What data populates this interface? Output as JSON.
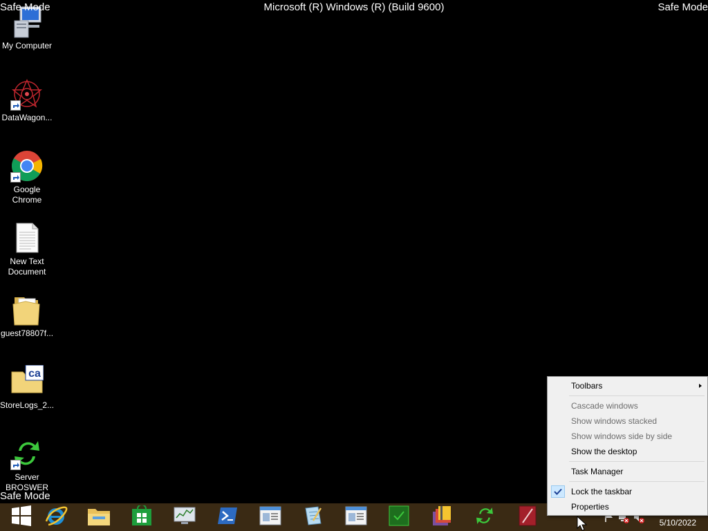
{
  "overlay": {
    "safe_mode": "Safe Mode",
    "build": "Microsoft (R) Windows (R) (Build 9600)"
  },
  "desktop": {
    "icons": [
      {
        "label": "My Computer",
        "icon": "computer-icon"
      },
      {
        "label": "DataWagon...",
        "icon": "datawagon-icon"
      },
      {
        "label": "Google Chrome",
        "icon": "chrome-icon"
      },
      {
        "label": "New Text Document",
        "icon": "text-document-icon"
      },
      {
        "label": "guest78807f...",
        "icon": "folder-icon"
      },
      {
        "label": "StoreLogs_2...",
        "icon": "ca-folder-icon"
      },
      {
        "label": "Server BROSWER",
        "icon": "server-browser-icon"
      }
    ]
  },
  "taskbar": {
    "buttons": [
      {
        "name": "start-button",
        "icon": "windows-logo-icon"
      },
      {
        "name": "internet-explorer",
        "icon": "ie-icon"
      },
      {
        "name": "file-explorer",
        "icon": "file-explorer-icon"
      },
      {
        "name": "store",
        "icon": "store-icon"
      },
      {
        "name": "performance-monitor",
        "icon": "monitor-chart-icon"
      },
      {
        "name": "powershell",
        "icon": "powershell-icon"
      },
      {
        "name": "window-app-1",
        "icon": "window-icon"
      },
      {
        "name": "notepad-app",
        "icon": "notepad-icon"
      },
      {
        "name": "window-app-2",
        "icon": "window-icon"
      },
      {
        "name": "green-app",
        "icon": "green-app-icon"
      },
      {
        "name": "archive-app",
        "icon": "archive-icon"
      },
      {
        "name": "sync-app",
        "icon": "sync-icon"
      },
      {
        "name": "red-app",
        "icon": "red-app-icon"
      }
    ],
    "clock_date": "5/10/2022",
    "tray_icons": [
      "flag-icon",
      "network-error-icon",
      "speaker-muted-icon"
    ]
  },
  "context_menu": {
    "items": [
      {
        "label": "Toolbars",
        "submenu": true,
        "enabled": true
      },
      {
        "label": "Cascade windows",
        "enabled": false
      },
      {
        "label": "Show windows stacked",
        "enabled": false
      },
      {
        "label": "Show windows side by side",
        "enabled": false
      },
      {
        "label": "Show the desktop",
        "enabled": true
      },
      {
        "label": "Task Manager",
        "enabled": true
      },
      {
        "label": "Lock the taskbar",
        "checked": true,
        "enabled": true
      },
      {
        "label": "Properties",
        "enabled": true
      }
    ]
  },
  "colors": {
    "desktop_bg": "#000000",
    "taskbar_bg": "#3a2a14",
    "menu_bg": "#f0f0f0",
    "menu_disabled_text": "#6d6d6d"
  }
}
